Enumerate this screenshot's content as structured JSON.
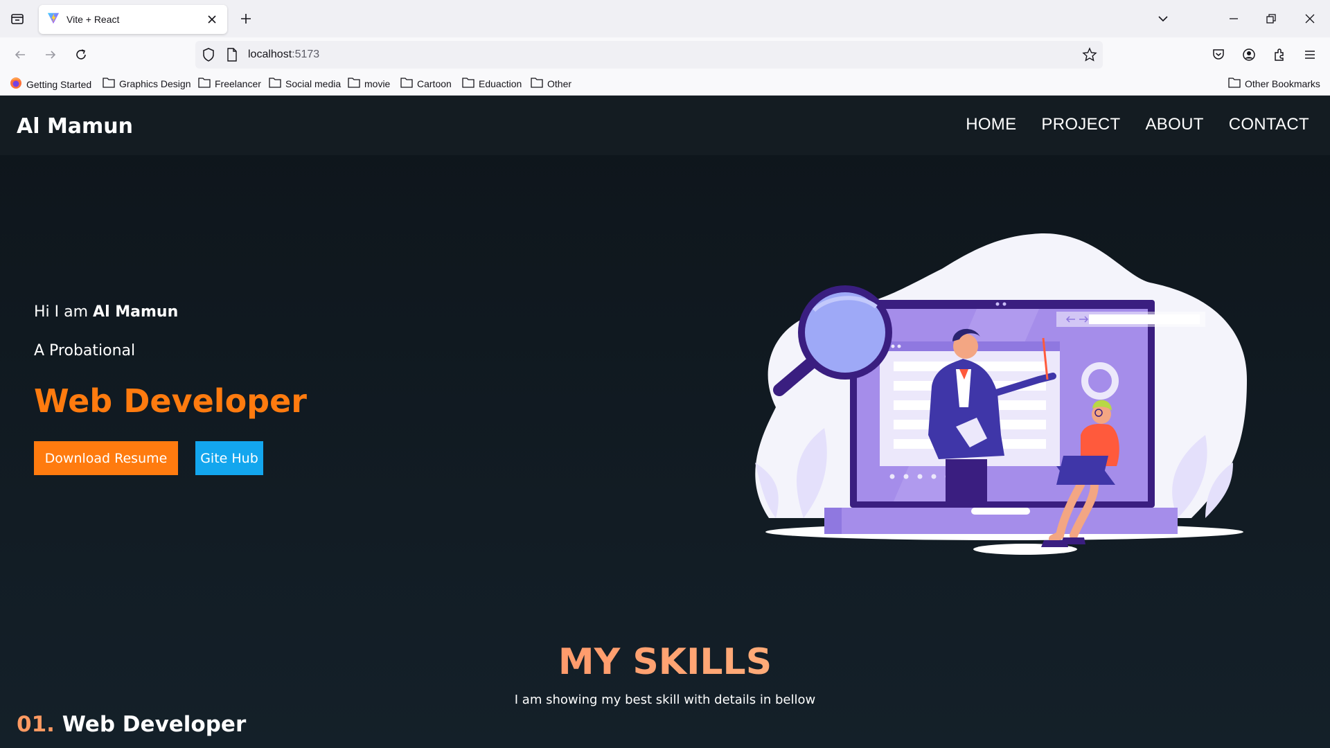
{
  "browser": {
    "tab_title": "Vite + React",
    "url_host": "localhost",
    "url_port": ":5173",
    "bookmarks": [
      "Getting Started",
      "Graphics Design",
      "Freelancer",
      "Social media",
      "movie",
      "Cartoon",
      "Eduaction",
      "Other"
    ],
    "other_bookmarks": "Other Bookmarks"
  },
  "site": {
    "brand": "Al Mamun",
    "nav": [
      "HOME",
      "PROJECT",
      "ABOUT",
      "CONTACT"
    ]
  },
  "hero": {
    "greet_prefix": "Hi I am ",
    "greet_name": "Al Mamun",
    "tagline": "A Probational",
    "role": "Web Developer",
    "resume_btn": "Download Resume",
    "github_btn": "Gite Hub"
  },
  "skills": {
    "title": "MY SKILLS",
    "subtitle": "I am showing my best skill with details in bellow",
    "first_num": "01.",
    "first_name": " Web Developer"
  },
  "colors": {
    "accent_orange": "#ff7b0f",
    "accent_blue": "#13a6ee",
    "page_bg": "#0e151b",
    "header_bg": "#141c22"
  }
}
